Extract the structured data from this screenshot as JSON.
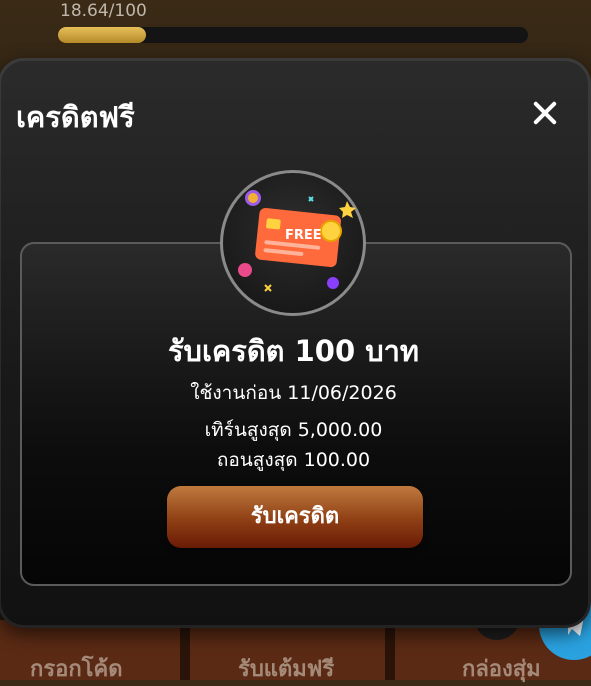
{
  "background": {
    "progress_text": "18.64/100",
    "progress_fraction": 0.1864,
    "bottom_nav": [
      {
        "label": "กรอกโค้ด"
      },
      {
        "label": "รับแต้มฟรี"
      },
      {
        "label": "กล่องสุ่ม"
      }
    ]
  },
  "modal": {
    "title": "เครดิตฟรี",
    "close_icon": "close-icon",
    "card_icon_text": "FREE",
    "credit_title": "รับเครดิต 100 บาท",
    "use_before": "ใช้งานก่อน 11/06/2026",
    "max_turnover": "เทิร์นสูงสุด 5,000.00",
    "max_withdraw": "ถอนสูงสุด 100.00",
    "claim_button": "รับเครดิต"
  },
  "colors": {
    "accent_gold": "#e7bf58",
    "button_brown": "#8e3f14",
    "card_orange": "#ff6a3d"
  }
}
